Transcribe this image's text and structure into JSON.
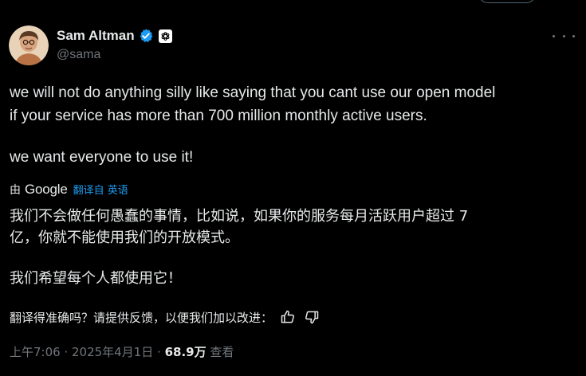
{
  "author": {
    "name": "Sam Altman",
    "handle": "@sama"
  },
  "tweet": {
    "paragraph1_line1": "we will not do anything silly like saying that you cant use our open model",
    "paragraph1_line2": "if your service has more than 700 million monthly active users.",
    "paragraph2": "we want everyone to use it!"
  },
  "translation": {
    "by_label": "由",
    "provider": "Google",
    "translated_from": "翻译自 英语",
    "line1": "我们不会做任何愚蠢的事情，比如说，如果你的服务每月活跃用户超过 7",
    "line2": "亿，你就不能使用我们的开放模式。",
    "line3": "我们希望每个人都使用它！",
    "feedback_prompt": "翻译得准确吗？请提供反馈，以便我们加以改进："
  },
  "meta": {
    "time": "上午7:06",
    "date": "2025年4月1日",
    "separator": " · ",
    "views_count": "68.9万",
    "views_label": "查看"
  },
  "colors": {
    "background": "#000000",
    "text": "#e7e9ea",
    "secondary": "#71767b",
    "link": "#1d9bf0",
    "verified": "#1d9bf0"
  },
  "icons": {
    "verified": "verified-badge-icon",
    "affiliate": "openai-logo-icon",
    "more": "more-options-icon",
    "thumbs_up": "thumbs-up-icon",
    "thumbs_down": "thumbs-down-icon"
  }
}
